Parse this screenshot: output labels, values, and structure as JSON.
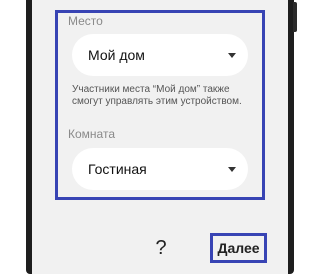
{
  "location": {
    "label": "Место",
    "selected": "Мой дом",
    "helper": "Участники места “Мой дом” также смогут управлять этим устройством."
  },
  "room": {
    "label": "Комната",
    "selected": "Гостиная"
  },
  "footer": {
    "help": "?",
    "next_label": "Далее"
  },
  "colors": {
    "highlight": "#3844b4",
    "screen_background": "#f1f1f1",
    "phone_frame": "#1e1e1e"
  }
}
